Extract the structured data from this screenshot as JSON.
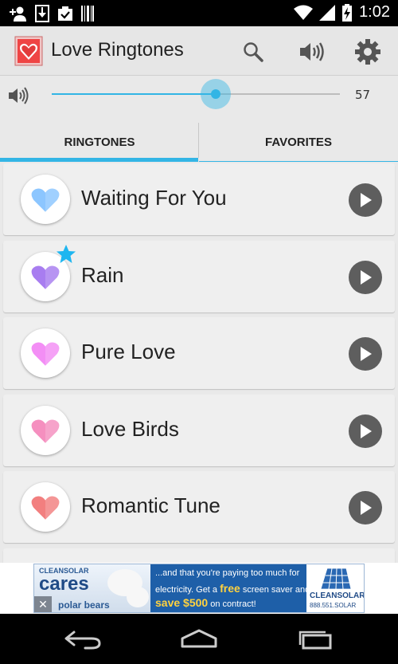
{
  "status_bar": {
    "time": "1:02",
    "left_icons": [
      "add-contact-icon",
      "download-icon",
      "clipboard-check-icon",
      "barcode-icon"
    ],
    "right_icons": [
      "wifi-icon",
      "signal-icon",
      "battery-charging-icon"
    ]
  },
  "action_bar": {
    "title": "Love Ringtones",
    "icons": [
      "search-icon",
      "volume-icon",
      "settings-icon"
    ]
  },
  "volume": {
    "value": "57",
    "level": 0.57,
    "icon": "volume-icon",
    "accent": "#33b5e5"
  },
  "tabs": [
    {
      "label": "RINGTONES",
      "selected": true
    },
    {
      "label": "FAVORITES",
      "selected": false
    }
  ],
  "ringtones": [
    {
      "name": "Waiting For You",
      "heart_color": "#8cc6ff",
      "favorite": false
    },
    {
      "name": "Rain",
      "heart_color": "#a87df0",
      "favorite": true
    },
    {
      "name": "Pure Love",
      "heart_color": "#f38ef5",
      "favorite": false
    },
    {
      "name": "Love Birds",
      "heart_color": "#f58fbf",
      "favorite": false
    },
    {
      "name": "Romantic Tune",
      "heart_color": "#f27f7f",
      "favorite": false
    }
  ],
  "ad": {
    "brand_small": "CLEANSOLAR",
    "headline": "cares",
    "subline": "polar bears",
    "line1": "...and that you're paying too much for",
    "line2": "electricity. Get a",
    "line2_bold": "free",
    "line2_end": "screen saver and",
    "line3_bold": "save $500",
    "line3_end": "on contract!",
    "logo_text": "CLEANSOLAR",
    "phone": "888.551.SOLAR",
    "close": "✕"
  },
  "nav_bar": {
    "icons": [
      "back-icon",
      "home-icon",
      "recent-apps-icon"
    ]
  }
}
